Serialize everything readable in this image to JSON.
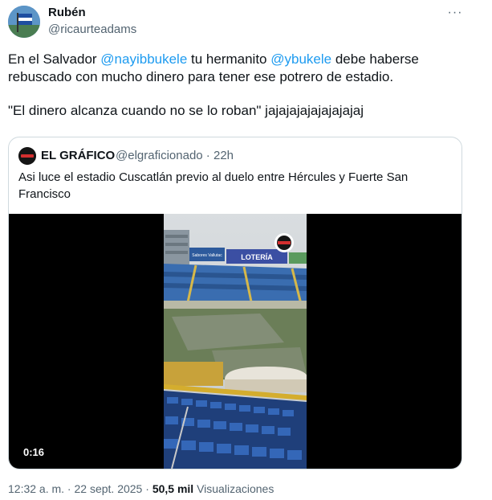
{
  "author": {
    "name": "Rubén",
    "handle": "@ricaurteadams",
    "more_label": "···"
  },
  "tweet": {
    "line1_prefix": "En el Salvador ",
    "mention1": "@nayibbukele",
    "line1_mid": " tu hermanito ",
    "mention2": "@ybukele",
    "line1_suffix": " debe haberse rebuscado con mucho dinero para tener ese potrero de estadio.",
    "line2": "\"El dinero alcanza cuando no se lo roban\" jajajajajajajajajaj"
  },
  "quote": {
    "name": "EL GRÁFICO",
    "handle": "@elgraficionado",
    "separator": " · ",
    "time": "22h",
    "text": "Asi luce el estadio Cuscatlán previo al duelo entre Hércules y Fuerte San Francisco",
    "video": {
      "duration": "0:16",
      "banner_left": "Sabores Vallutac",
      "banner_right": "LOTERÍA"
    }
  },
  "meta": {
    "time": "12:32 a. m.",
    "separator": " · ",
    "date": "22 sept. 2025",
    "views_count": "50,5 mil",
    "views_label": "Visualizaciones"
  },
  "colors": {
    "link": "#1d9bf0",
    "secondary_text": "#536471",
    "border": "#cfd9de"
  }
}
